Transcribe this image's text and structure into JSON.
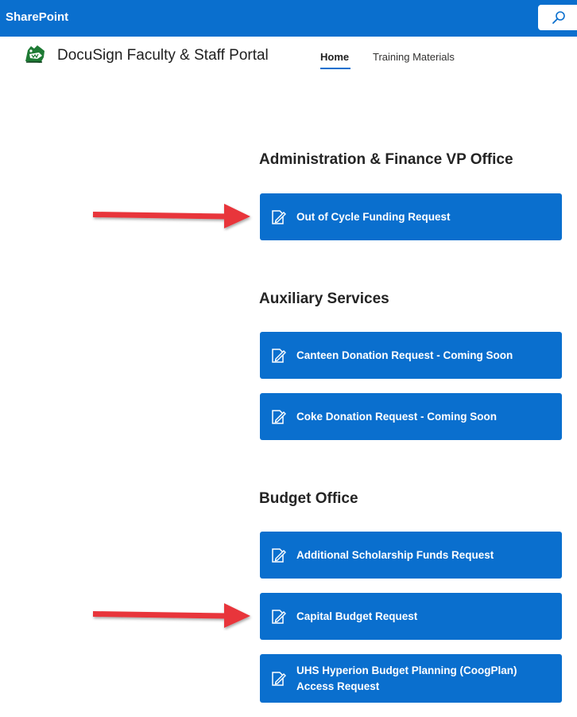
{
  "suitebar": {
    "title": "SharePoint"
  },
  "site": {
    "title": "DocuSign Faculty & Staff Portal",
    "nav": {
      "home": "Home",
      "training": "Training Materials"
    }
  },
  "sections": [
    {
      "heading": "Administration & Finance VP Office",
      "buttons": [
        "Out of Cycle Funding Request"
      ]
    },
    {
      "heading": "Auxiliary Services",
      "buttons": [
        "Canteen Donation Request - Coming Soon",
        "Coke Donation Request - Coming Soon"
      ]
    },
    {
      "heading": "Budget Office",
      "buttons": [
        "Additional Scholarship Funds Request",
        "Capital Budget Request",
        "UHS Hyperion Budget Planning (CoogPlan) Access Request"
      ]
    }
  ],
  "colors": {
    "accent": "#0a6fce",
    "arrow": "#e8363a"
  },
  "icons": {
    "search": "search-icon",
    "button": "edit-form-icon",
    "logo": "cougar-logo"
  }
}
